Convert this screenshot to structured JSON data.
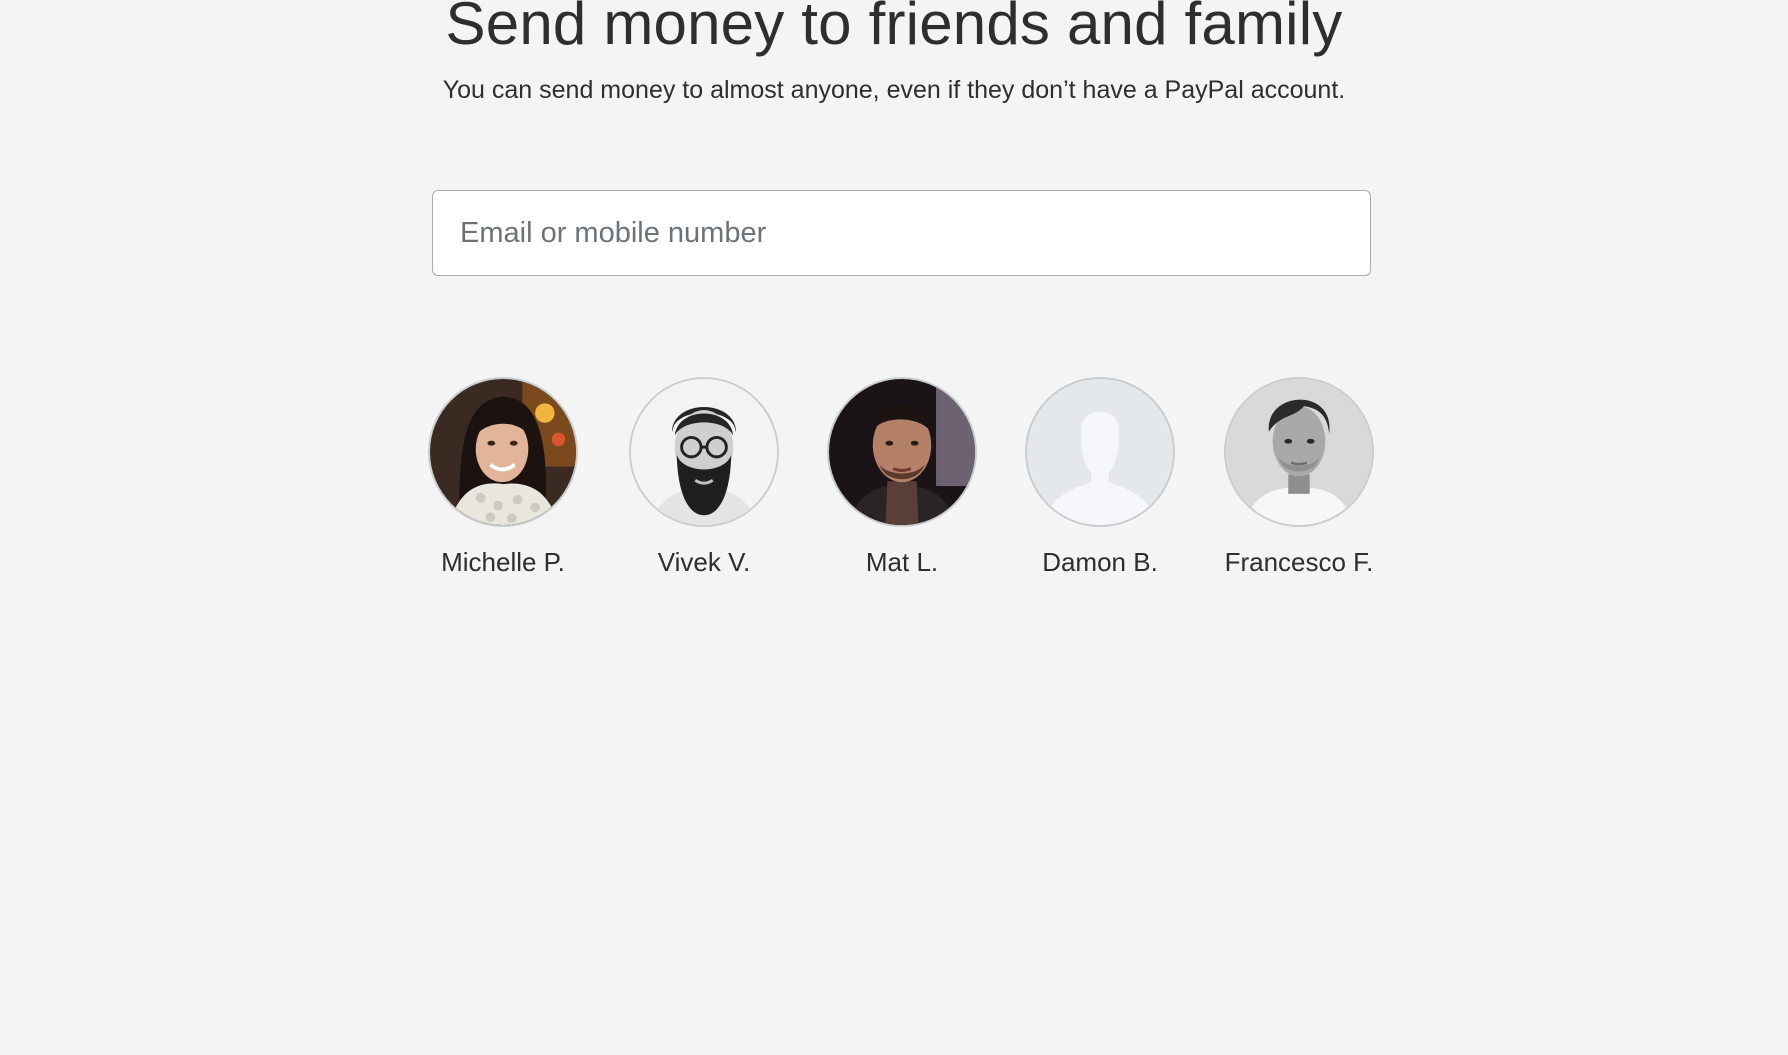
{
  "header": {
    "title": "Send money to friends and family",
    "subtitle": "You can send money to almost anyone, even if they don’t have a PayPal account."
  },
  "recipient": {
    "placeholder": "Email or mobile number",
    "value": ""
  },
  "contacts": [
    {
      "name": "Michelle P.",
      "avatar": "photo-woman-smiling-scarf"
    },
    {
      "name": "Vivek V.",
      "avatar": "photo-man-glasses-beard-grayscale"
    },
    {
      "name": "Mat L.",
      "avatar": "photo-man-dark-background"
    },
    {
      "name": "Damon B.",
      "avatar": "default-person-silhouette"
    },
    {
      "name": "Francesco F.",
      "avatar": "photo-man-grayscale"
    }
  ],
  "colors": {
    "background": "#f4f4f4",
    "text": "#2c2e2f",
    "placeholder": "#6c7378",
    "field_border": "#a9aeb1",
    "avatar_border": "#c9cdd0",
    "silhouette_bg": "#e4e8eb",
    "silhouette_fg": "#f5f7fa"
  }
}
